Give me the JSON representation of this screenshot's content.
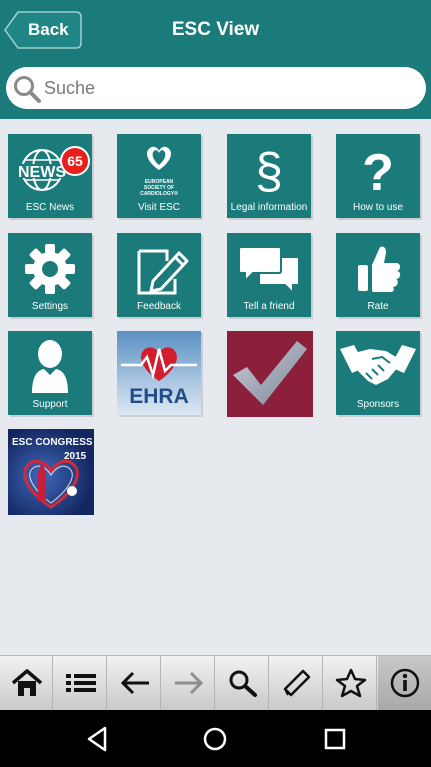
{
  "header": {
    "back_label": "Back",
    "title": "ESC View"
  },
  "search": {
    "placeholder": "Suche"
  },
  "tiles": [
    {
      "label": "ESC News",
      "icon": "news-icon",
      "badge": "65"
    },
    {
      "label": "Visit ESC",
      "icon": "esc-logo-icon",
      "logo_text": "EUROPEAN SOCIETY OF CARDIOLOGY®"
    },
    {
      "label": "Legal information",
      "icon": "paragraph-icon"
    },
    {
      "label": "How to use",
      "icon": "question-icon"
    },
    {
      "label": "Settings",
      "icon": "gear-icon"
    },
    {
      "label": "Feedback",
      "icon": "edit-note-icon"
    },
    {
      "label": "Tell a friend",
      "icon": "chat-bubbles-icon"
    },
    {
      "label": "Rate",
      "icon": "thumbs-up-icon"
    },
    {
      "label": "Support",
      "icon": "person-icon"
    },
    {
      "label": "",
      "icon": "ehra-app-icon",
      "logo_text": "EHRA"
    },
    {
      "label": "",
      "icon": "checkmark-app-icon"
    },
    {
      "label": "Sponsors",
      "icon": "handshake-icon"
    },
    {
      "label": "",
      "icon": "esc-congress-app-icon",
      "logo_text": "ESC CONGRESS",
      "year": "2015"
    }
  ],
  "bottom_nav": [
    "home-icon",
    "list-icon",
    "back-arrow-icon",
    "forward-arrow-icon",
    "search-icon",
    "pen-icon",
    "star-icon",
    "info-icon"
  ],
  "system_nav": [
    "back-triangle-icon",
    "home-circle-icon",
    "recents-square-icon"
  ],
  "colors": {
    "header": "#1b7b7b",
    "tile": "#1b7b7b",
    "badge": "#e8201c",
    "check_tile": "#8c1f39",
    "background": "#e6e9ed"
  }
}
